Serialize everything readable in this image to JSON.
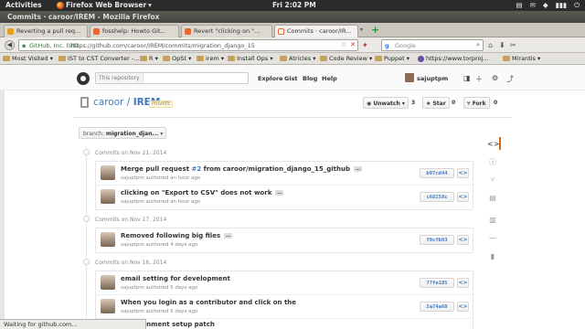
{
  "top_panel": {
    "activities": "Activities",
    "app_name": "Firefox Web Browser",
    "app_caret": "▾",
    "clock": "Fri  2:02 PM",
    "tray": [
      "▤",
      "✉",
      "◆",
      "▮▮▮",
      "⏻"
    ]
  },
  "window": {
    "title": "Commits · caroor/IREM - Mozilla Firefox"
  },
  "tabs": [
    {
      "label": "Reverting a pull req...",
      "icon_color": "#e0a020",
      "active": false
    },
    {
      "label": "fosshelp: Howto Git...",
      "icon_color": "#e8672c",
      "active": false
    },
    {
      "label": "Revert \"clicking on \"...",
      "icon_color": "#e8672c",
      "active": false
    },
    {
      "label": "Commits · caroor/IR...",
      "icon_color": "#ffffff",
      "active": true
    }
  ],
  "tab_scroll": "▾",
  "newtab_label": "+",
  "navbar": {
    "identity": "GitHub, Inc. (US)",
    "url": "https://github.com/caroor/IREM/commits/migration_django_15",
    "star": "☆",
    "stop": "✕",
    "search_engine": "g",
    "search_placeholder": "Google",
    "search_icon": "⌕",
    "back": "◀",
    "icons": [
      "⌂",
      "⬇",
      "✂"
    ]
  },
  "bookmarks": [
    {
      "label": "Most Visited ▾",
      "type": "folder"
    },
    {
      "label": "IST to CST Converter -...",
      "type": "folder"
    },
    {
      "label": "R ▾",
      "type": "folder"
    },
    {
      "label": "OpSt ▾",
      "type": "folder"
    },
    {
      "label": "irem ▾",
      "type": "folder"
    },
    {
      "label": "Install Ops ▾",
      "type": "folder"
    },
    {
      "label": "Atricles ▾",
      "type": "folder"
    },
    {
      "label": "Code Review ▾",
      "type": "folder"
    },
    {
      "label": "Puppet ▾",
      "type": "folder"
    },
    {
      "label": "https://www.torproj...",
      "type": "link"
    },
    {
      "label": "Mirantis ▾",
      "type": "folder"
    }
  ],
  "gh_header": {
    "search_scope": "This repository",
    "nav": [
      "Explore",
      "Gist",
      "Blog",
      "Help"
    ],
    "username": "sajuptpm",
    "icons": [
      "＋",
      "⚙",
      "⤴"
    ]
  },
  "repo": {
    "owner": "caroor",
    "separator": " / ",
    "name": "IREM",
    "visibility": "PRIVATE",
    "watch_label": "◉ Unwatch ▾",
    "watch_count": "3",
    "star_label": "★ Star",
    "star_count": "0",
    "fork_label": "⑂ Fork",
    "fork_count": "0"
  },
  "branch": {
    "prefix": "branch:",
    "name": "migration_djan...",
    "caret": "▾"
  },
  "commit_days": [
    {
      "date": "Commits on Nov 21, 2014",
      "commits": [
        {
          "message": "Merge pull request ",
          "link": "#2",
          "message_rest": " from caroor/migration_django_15_github",
          "meta": "sajuptpm authored an hour ago",
          "sha": "b97cd44",
          "has_ellipsis": true
        },
        {
          "message": "clicking on \"Export to CSV\" does not work",
          "link": "",
          "message_rest": "",
          "meta": "sajuptpm authored an hour ago",
          "sha": "c68258c",
          "has_ellipsis": true
        }
      ]
    },
    {
      "date": "Commits on Nov 17, 2014",
      "commits": [
        {
          "message": "Removed following big files",
          "link": "",
          "message_rest": "",
          "meta": "sajuptpm authored 4 days ago",
          "sha": "f8cfb93",
          "has_ellipsis": true
        }
      ]
    },
    {
      "date": "Commits on Nov 16, 2014",
      "commits": [
        {
          "message": "email setting for development",
          "link": "",
          "message_rest": "",
          "meta": "sajuptpm authored 5 days ago",
          "sha": "77fe185",
          "has_ellipsis": false
        },
        {
          "message": "When you login as a contributor and click on the",
          "link": "",
          "message_rest": "",
          "meta": "sajuptpm authored 5 days ago",
          "sha": "2a74a60",
          "has_ellipsis": true
        },
        {
          "message": "...nvironment setup patch",
          "link": "",
          "message_rest": "",
          "meta": "",
          "sha": "",
          "has_ellipsis": false
        }
      ]
    }
  ],
  "ellipsis_label": "…",
  "browse_label": "<>",
  "sidenav": [
    "<>",
    "ⓘ",
    "⑂",
    "▤",
    "▥",
    "⁓",
    "▮"
  ],
  "status_text": "Waiting for github.com..."
}
